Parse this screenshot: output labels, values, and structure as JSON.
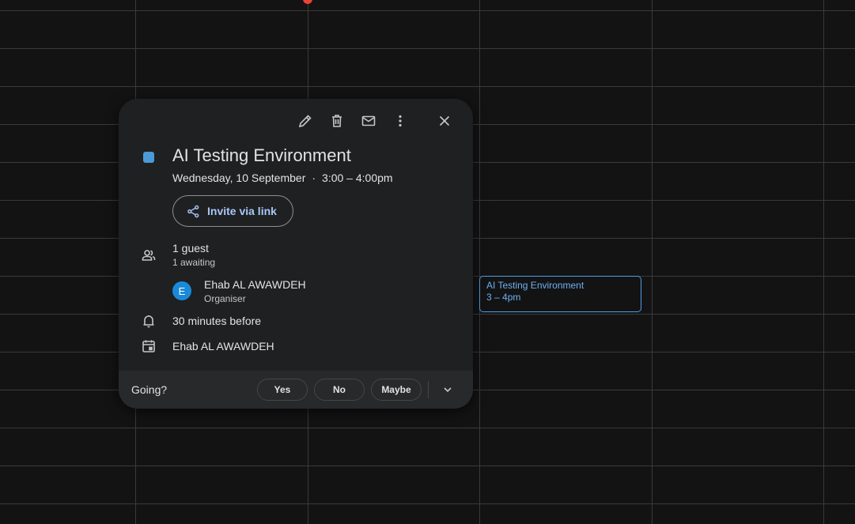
{
  "popup": {
    "title": "AI Testing Environment",
    "date": "Wednesday, 10 September",
    "separator": "·",
    "time": "3:00 – 4:00pm",
    "event_color": "#4a9ad8",
    "invite_label": "Invite via link",
    "guests": {
      "count": "1 guest",
      "status": "1 awaiting"
    },
    "organiser": {
      "initial": "E",
      "name": "Ehab AL AWAWDEH",
      "role": "Organiser"
    },
    "reminder": "30 minutes before",
    "calendar": "Ehab AL AWAWDEH",
    "footer": {
      "prompt": "Going?",
      "yes": "Yes",
      "no": "No",
      "maybe": "Maybe"
    }
  },
  "event_chip": {
    "title": "AI Testing Environment",
    "time": "3 – 4pm",
    "color": "#4c9fe6"
  }
}
